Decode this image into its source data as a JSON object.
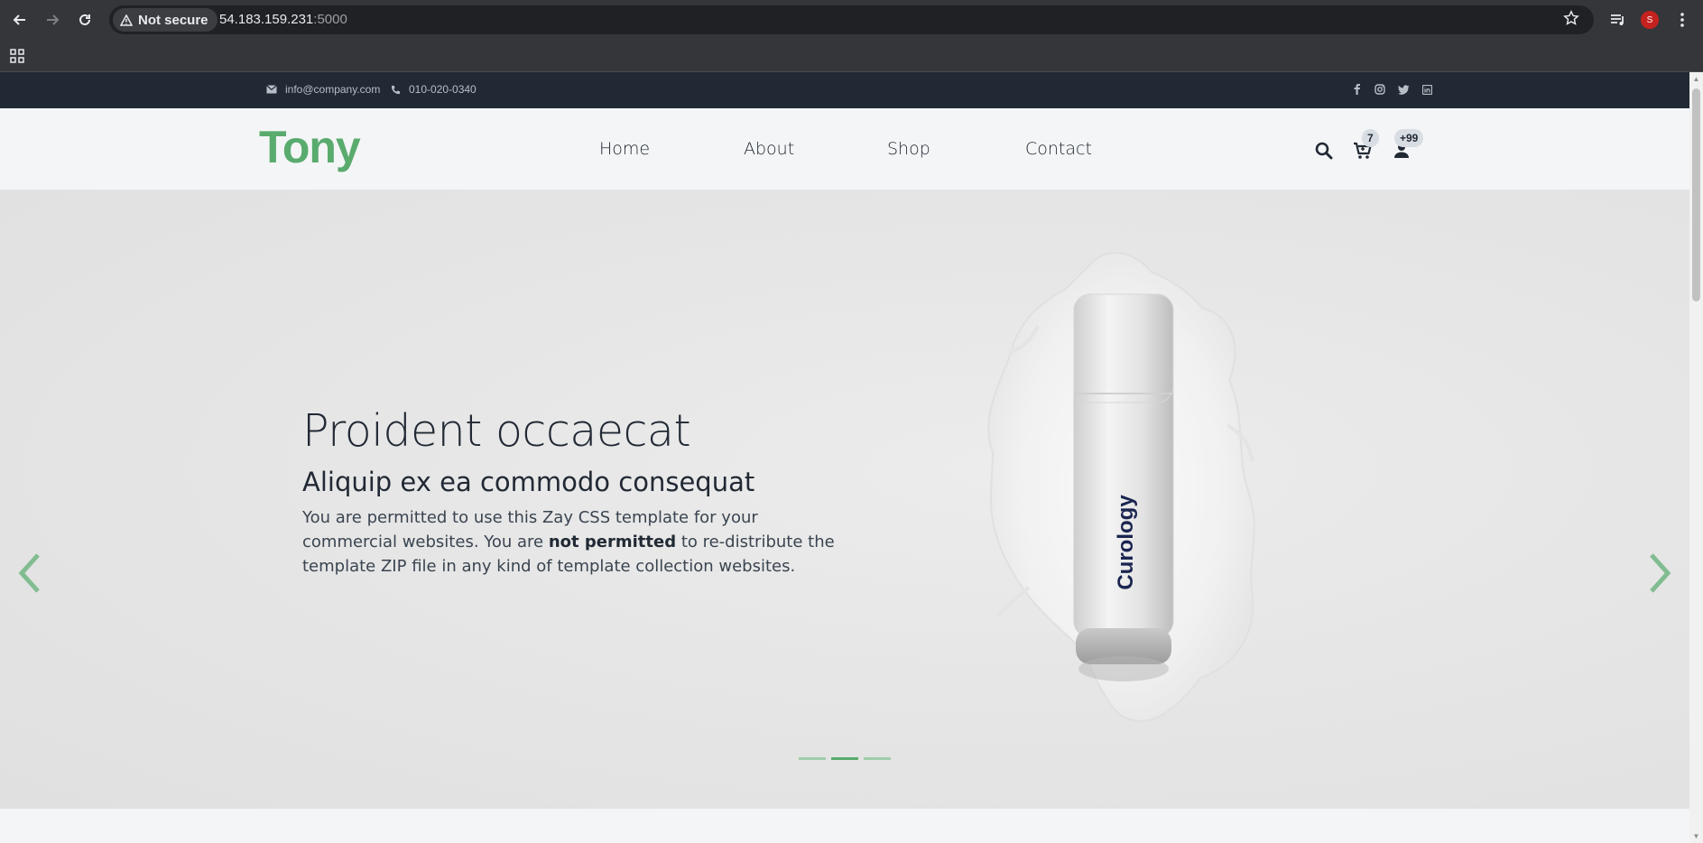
{
  "browser": {
    "security_label": "Not secure",
    "url_host": "54.183.159.231",
    "url_port": ":5000",
    "profile_initial": "S"
  },
  "topbar": {
    "email": "info@company.com",
    "phone": "010-020-0340",
    "social_icons": [
      "facebook-icon",
      "instagram-icon",
      "twitter-icon",
      "linkedin-icon"
    ]
  },
  "header": {
    "logo": "Tony",
    "nav": [
      {
        "label": "Home"
      },
      {
        "label": "About"
      },
      {
        "label": "Shop"
      },
      {
        "label": "Contact"
      }
    ],
    "cart_count": "7",
    "user_count": "+99"
  },
  "hero": {
    "title": "Proident occaecat",
    "subtitle": "Aliquip ex ea commodo consequat",
    "text_part1": "You are permitted to use this Zay CSS template for your commercial websites. You are ",
    "text_bold": "not permitted",
    "text_part2": " to re-distribute the template ZIP file in any kind of template collection websites.",
    "product_brand": "Curology",
    "slide_count": 3,
    "active_slide": 2
  },
  "colors": {
    "brand_green": "#59ab6e",
    "dark": "#212934",
    "indicator_inactive": "#9fcdaa"
  }
}
